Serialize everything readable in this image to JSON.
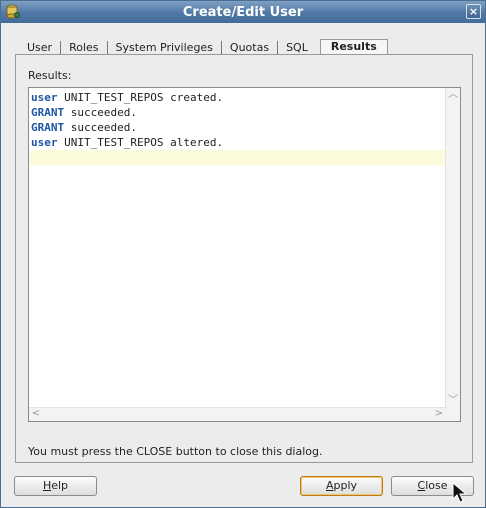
{
  "window": {
    "title": "Create/Edit User",
    "close_glyph": "×"
  },
  "tabs": [
    {
      "label": "User"
    },
    {
      "label": "Roles"
    },
    {
      "label": "System Privileges"
    },
    {
      "label": "Quotas"
    },
    {
      "label": "SQL"
    },
    {
      "label": "Results",
      "active": true
    }
  ],
  "results": {
    "label": "Results:",
    "lines": [
      {
        "keyword": "user",
        "rest": " UNIT_TEST_REPOS created."
      },
      {
        "keyword": "GRANT",
        "rest": " succeeded."
      },
      {
        "keyword": "GRANT",
        "rest": " succeeded."
      },
      {
        "keyword": "user",
        "rest": " UNIT_TEST_REPOS altered."
      }
    ]
  },
  "message": "You must press the CLOSE button to close this dialog.",
  "buttons": {
    "help": {
      "mnemonic": "H",
      "rest": "elp"
    },
    "apply": {
      "mnemonic": "A",
      "rest": "pply"
    },
    "close": {
      "mnemonic": "C",
      "rest": "lose"
    }
  },
  "colors": {
    "titlebar": "#4f78a6",
    "keyword": "#1f57a5",
    "current_line": "#fbfbdc",
    "default_button_border": "#c07a1c"
  },
  "icons": {
    "title": "database-user-icon",
    "close": "close-icon",
    "pointer": "mouse-pointer-icon"
  }
}
